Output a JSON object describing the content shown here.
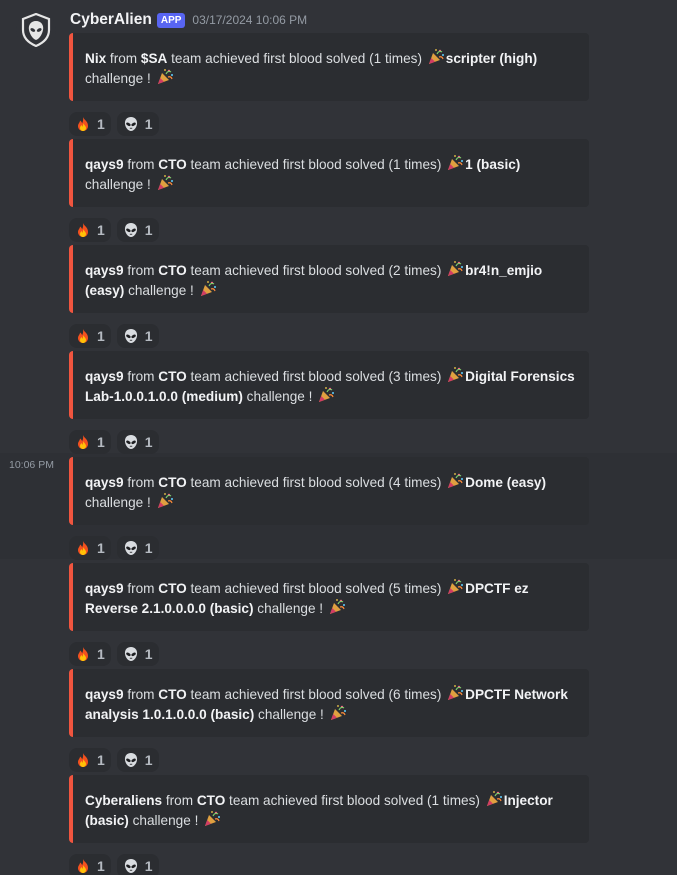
{
  "author": {
    "name": "CyberAlien",
    "badge": "APP",
    "timestamp": "03/17/2024 10:06 PM"
  },
  "side_timestamp": "10:06 PM",
  "accent_color": "#f0553f",
  "messages": [
    {
      "pre": "",
      "who": "Nix",
      "from": " from ",
      "team": "$SA",
      "mid": " team achieved first blood solved (1 times) ",
      "challenge": "scripter (high)",
      "tail": " challenge ! ",
      "reactions": [
        {
          "icon": "fire-icon",
          "count": "1"
        },
        {
          "icon": "alien-icon",
          "count": "1"
        }
      ]
    },
    {
      "pre": "",
      "who": "qays9",
      "from": " from ",
      "team": "CTO",
      "mid": " team achieved first blood solved (1 times) ",
      "challenge": "1 (basic)",
      "tail": " challenge ! ",
      "reactions": [
        {
          "icon": "fire-icon",
          "count": "1"
        },
        {
          "icon": "alien-icon",
          "count": "1"
        }
      ]
    },
    {
      "pre": "",
      "who": "qays9",
      "from": " from ",
      "team": "CTO",
      "mid": " team achieved first blood solved (2 times) ",
      "challenge": "br4!n_emjio (easy)",
      "tail": " challenge ! ",
      "reactions": [
        {
          "icon": "fire-icon",
          "count": "1"
        },
        {
          "icon": "alien-icon",
          "count": "1"
        }
      ]
    },
    {
      "pre": "",
      "who": "qays9",
      "from": " from ",
      "team": "CTO",
      "mid": " team achieved first blood solved (3 times) ",
      "challenge": "Digital Forensics Lab-1.0.0.1.0.0 (medium)",
      "tail": " challenge ! ",
      "reactions": [
        {
          "icon": "fire-icon",
          "count": "1"
        },
        {
          "icon": "alien-icon",
          "count": "1"
        }
      ]
    },
    {
      "pre": "",
      "who": "qays9",
      "from": " from ",
      "team": "CTO",
      "mid": " team achieved first blood solved (4 times) ",
      "challenge": "Dome (easy)",
      "tail": " challenge ! ",
      "reactions": [
        {
          "icon": "fire-icon",
          "count": "1"
        },
        {
          "icon": "alien-icon",
          "count": "1"
        }
      ]
    },
    {
      "pre": "",
      "who": "qays9",
      "from": " from ",
      "team": "CTO",
      "mid": " team achieved first blood solved (5 times) ",
      "challenge": "DPCTF ez Reverse 2.1.0.0.0.0 (basic)",
      "tail": " challenge ! ",
      "reactions": [
        {
          "icon": "fire-icon",
          "count": "1"
        },
        {
          "icon": "alien-icon",
          "count": "1"
        }
      ]
    },
    {
      "pre": "",
      "who": "qays9",
      "from": " from ",
      "team": "CTO",
      "mid": " team achieved first blood solved (6 times) ",
      "challenge": "DPCTF Network analysis 1.0.1.0.0.0 (basic)",
      "tail": " challenge ! ",
      "reactions": [
        {
          "icon": "fire-icon",
          "count": "1"
        },
        {
          "icon": "alien-icon",
          "count": "1"
        }
      ]
    },
    {
      "pre": "",
      "who": "Cyberaliens",
      "from": " from ",
      "team": "CTO",
      "mid": " team achieved first blood solved (1 times) ",
      "challenge": "Injector (basic)",
      "tail": " challenge ! ",
      "reactions": [
        {
          "icon": "fire-icon",
          "count": "1"
        },
        {
          "icon": "alien-icon",
          "count": "1"
        }
      ]
    }
  ]
}
